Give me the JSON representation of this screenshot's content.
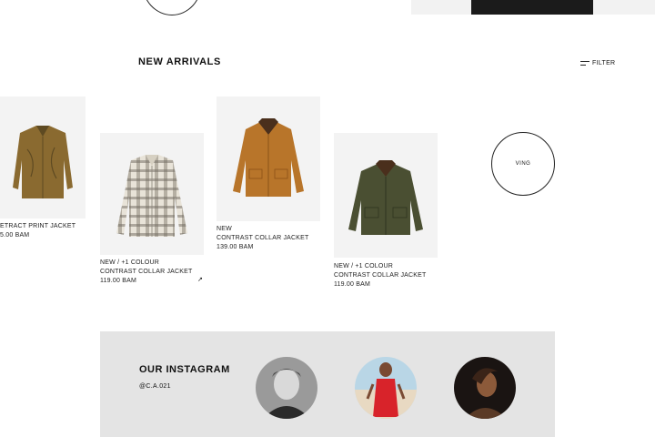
{
  "header": {
    "colors": {
      "banner": "#1b1b1b"
    }
  },
  "arrivals": {
    "title": "NEW ARRIVALS",
    "filter_label": "FILTER",
    "view_all_label": "VING",
    "products": [
      {
        "line1": "",
        "line2": "ETRACT PRINT JACKET",
        "price": "5.00 BAM",
        "color": "#8a6a30",
        "pattern": "solid"
      },
      {
        "line1": "NEW / +1 COLOUR",
        "line2": "CONTRAST COLLAR JACKET",
        "price": "119.00 BAM",
        "color": "#e8e3d8",
        "pattern": "check"
      },
      {
        "line1": "NEW",
        "line2": "CONTRAST COLLAR JACKET",
        "price": "139.00 BAM",
        "color": "#b8752a",
        "pattern": "solid"
      },
      {
        "line1": "NEW / +1 COLOUR",
        "line2": "CONTRAST COLLAR JACKET",
        "price": "119.00 BAM",
        "color": "#4a4f32",
        "pattern": "solid"
      }
    ],
    "wishlist_icon": "arrow-icon"
  },
  "instagram": {
    "title": "OUR INSTAGRAM",
    "handle": "@C.A.021",
    "background": "#e4e4e4",
    "posts": [
      {
        "tone": "bw-portrait"
      },
      {
        "tone": "beach-red-dress"
      },
      {
        "tone": "dark-portrait"
      }
    ]
  }
}
